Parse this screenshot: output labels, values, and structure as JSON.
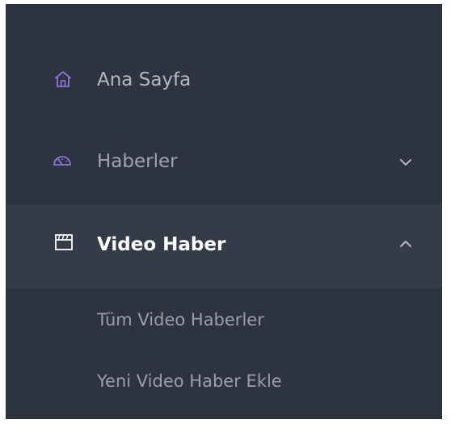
{
  "sidebar": {
    "items": [
      {
        "label": "Ana Sayfa",
        "icon": "home-icon"
      },
      {
        "label": "Haberler",
        "icon": "speedometer-icon",
        "expandable": true,
        "expanded": false
      },
      {
        "label": "Video Haber",
        "icon": "clapperboard-icon",
        "expandable": true,
        "expanded": true,
        "active": true,
        "children": [
          {
            "label": "Tüm Video Haberler"
          },
          {
            "label": "Yeni Video Haber Ekle"
          }
        ]
      }
    ]
  },
  "colors": {
    "sidebar_bg": "#2e3340",
    "active_bg": "#363b48",
    "icon_accent": "#8f73d8",
    "text_default": "#b4b7c0",
    "text_active": "#ffffff"
  }
}
